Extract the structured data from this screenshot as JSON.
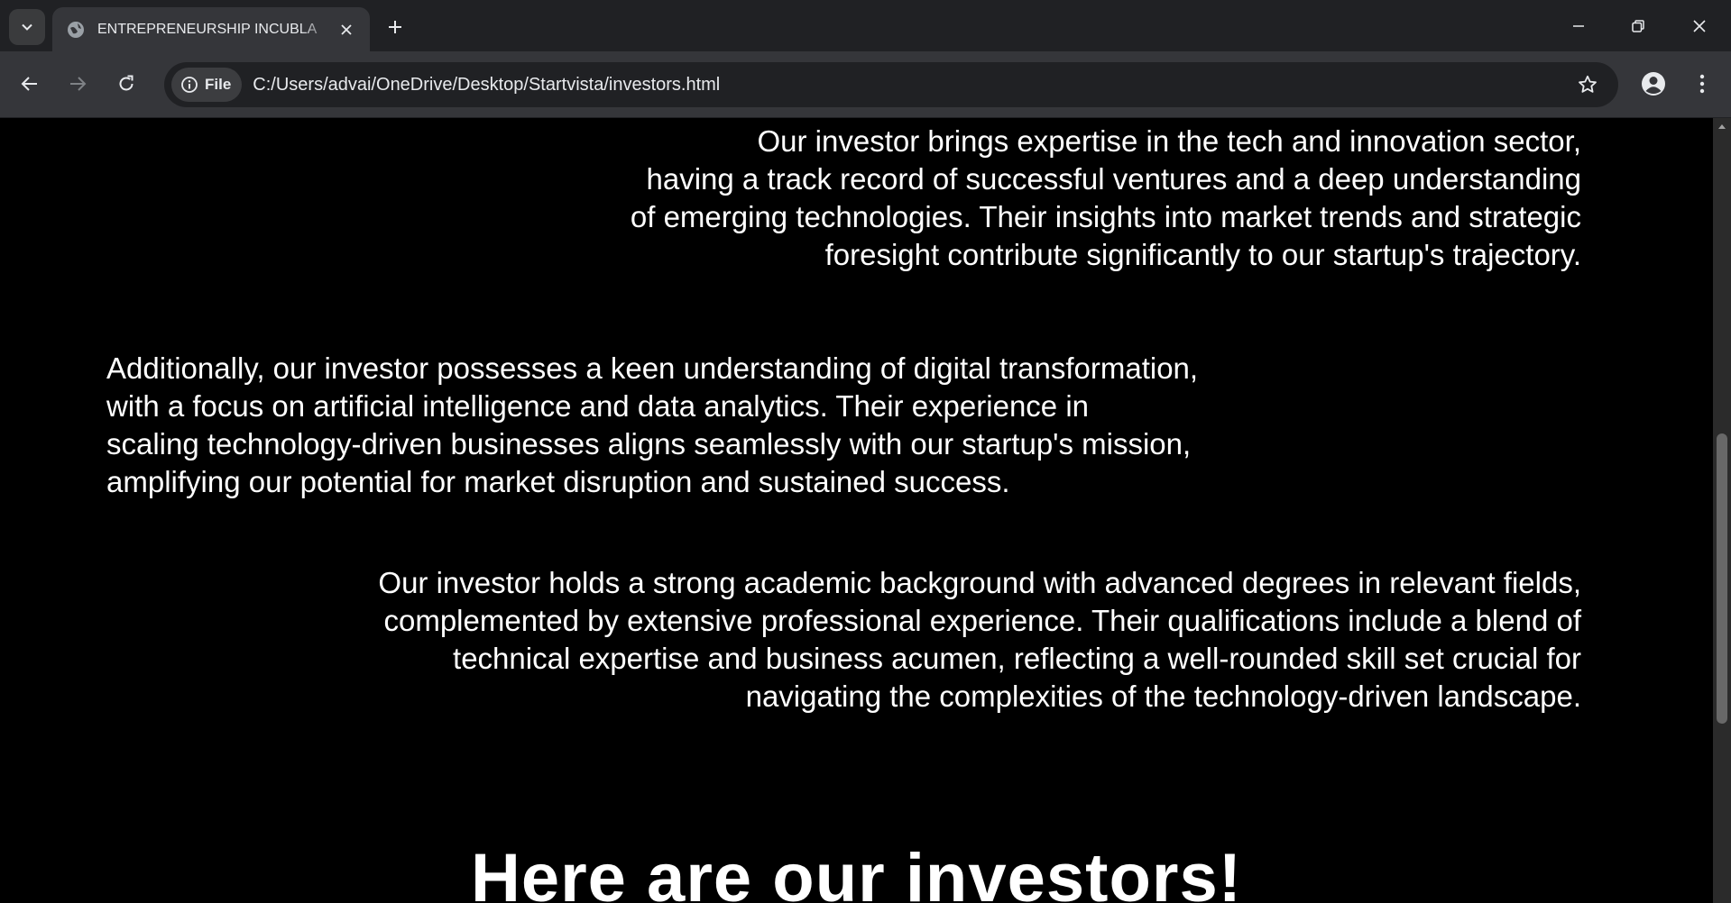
{
  "browser": {
    "tab_title": "ENTREPRENEURSHIP INCUBLA",
    "address": {
      "chip_label": "File",
      "url": "C:/Users/advai/OneDrive/Desktop/Startvista/investors.html"
    }
  },
  "icons": {
    "tab_search": "chevron-down-icon",
    "favicon": "globe-icon",
    "tab_close": "close-icon",
    "new_tab": "plus-icon",
    "minimize": "minimize-icon",
    "restore": "restore-icon",
    "close_window": "close-icon",
    "back": "arrow-left-icon",
    "forward": "arrow-right-icon",
    "reload": "reload-icon",
    "site_info": "info-icon",
    "bookmark": "star-icon",
    "profile": "person-icon",
    "menu": "kebab-menu-icon"
  },
  "page": {
    "paragraph1": [
      "Our investor brings expertise in the tech and innovation sector,",
      "having a track record of successful ventures and a deep understanding",
      "of emerging technologies. Their insights into market trends and strategic",
      "foresight contribute significantly to our startup's trajectory."
    ],
    "paragraph2": [
      "Additionally, our investor possesses a keen understanding of digital transformation,",
      "with a focus on artificial intelligence and data analytics. Their experience in",
      "scaling technology-driven businesses aligns seamlessly with our startup's mission,",
      "amplifying our potential for market disruption and sustained success."
    ],
    "paragraph3": [
      "Our investor holds a strong academic background with advanced degrees in relevant fields,",
      "complemented by extensive professional experience. Their qualifications include a blend of",
      "technical expertise and business acumen, reflecting a well-rounded skill set crucial for",
      "navigating the complexities of the technology-driven landscape."
    ],
    "heading": "Here are our investors!"
  },
  "colors": {
    "page_background": "#000000",
    "text": "#ffffff",
    "chrome_dark": "#202124",
    "chrome_toolbar": "#35363a"
  }
}
